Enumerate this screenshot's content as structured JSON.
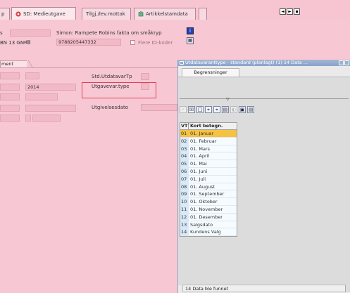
{
  "tabs": [
    {
      "label": "p",
      "icon": "none"
    },
    {
      "label": "SD: Medieutgave",
      "icon": "sd-icon",
      "active": true
    },
    {
      "label": "Tilgj./lev.mottak",
      "icon": "none"
    },
    {
      "label": "Artikkelstamdata",
      "icon": "artikkel-icon"
    }
  ],
  "tab_nav": [
    "◄",
    "►",
    "▪"
  ],
  "header": {
    "label_s": "s",
    "title_value": "Simon: Rampete Robins fakta om småkryp",
    "isbn_label": "BN 13 GNF",
    "isbn_value": "9788205447332",
    "flere_id_label": "Flere ID-koder"
  },
  "section_tab": "ment",
  "form": {
    "year_value": "2014",
    "std_utdatavar_label": "Std.UtdatavarTp",
    "utgavevar_type_label": "Utgavevar.type",
    "utgivelsesdato_label": "Utgivelsesdato"
  },
  "popup": {
    "title": "Utdatavaranttype - standard (planlagt) (1)   14 Data ...",
    "tab_label": "Begrensninger",
    "slider_glyph": "▽",
    "toolbar": [
      "✓",
      "☒",
      "□",
      "⌖",
      "⌖",
      "▤",
      "◐",
      "▣",
      "▤"
    ],
    "columns": {
      "code": "VTˆ",
      "name": "Kort betegn."
    },
    "rows": [
      {
        "code": "01",
        "name": "01. Januar"
      },
      {
        "code": "02",
        "name": "01. Februar"
      },
      {
        "code": "03",
        "name": "01. Mars"
      },
      {
        "code": "04",
        "name": "01. April"
      },
      {
        "code": "05",
        "name": "01. Mai"
      },
      {
        "code": "06",
        "name": "01. Juni"
      },
      {
        "code": "07",
        "name": "01. Juli"
      },
      {
        "code": "08",
        "name": "01. August"
      },
      {
        "code": "09",
        "name": "01. September"
      },
      {
        "code": "10",
        "name": "01. Oktober"
      },
      {
        "code": "11",
        "name": "01. November"
      },
      {
        "code": "12",
        "name": "01. Desember"
      },
      {
        "code": "13",
        "name": "Salgsdato"
      },
      {
        "code": "14",
        "name": "Kundens Valg"
      }
    ],
    "status": "14 Data ble funnet"
  },
  "colors": {
    "background": "#f7c8d4",
    "selected_row": "#f5c242",
    "popup_title": "#8aa3ca"
  }
}
